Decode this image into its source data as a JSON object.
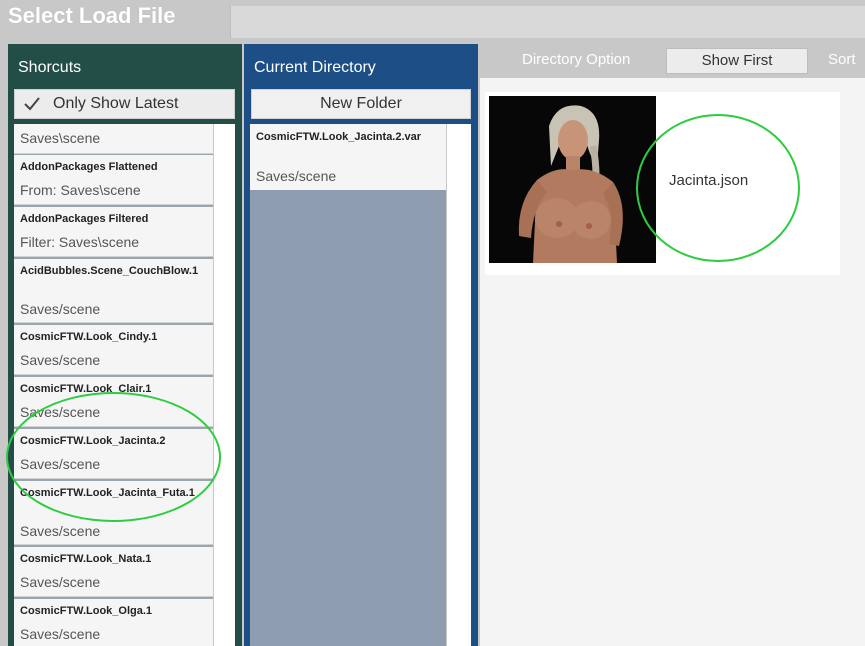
{
  "window": {
    "title": "Select Load File"
  },
  "shortcuts": {
    "header": "Shorcuts",
    "only_show_latest": "Only Show Latest",
    "checked": true,
    "items": [
      {
        "title": "",
        "subtitle": "Saves\\scene"
      },
      {
        "title": "AddonPackages Flattened",
        "subtitle": "From: Saves\\scene"
      },
      {
        "title": "AddonPackages Filtered",
        "subtitle": "Filter: Saves\\scene"
      },
      {
        "title": "AcidBubbles.Scene_CouchBlow.1",
        "subtitle": "Saves/scene"
      },
      {
        "title": "CosmicFTW.Look_Cindy.1",
        "subtitle": "Saves/scene"
      },
      {
        "title": "CosmicFTW.Look_Clair.1",
        "subtitle": "Saves/scene"
      },
      {
        "title": "CosmicFTW.Look_Jacinta.2",
        "subtitle": "Saves/scene"
      },
      {
        "title": "CosmicFTW.Look_Jacinta_Futa.1",
        "subtitle": "Saves/scene"
      },
      {
        "title": "CosmicFTW.Look_Nata.1",
        "subtitle": "Saves/scene"
      },
      {
        "title": "CosmicFTW.Look_Olga.1",
        "subtitle": "Saves/scene"
      }
    ]
  },
  "directory": {
    "header": "Current Directory",
    "new_folder": "New Folder",
    "item": {
      "title": "CosmicFTW.Look_Jacinta.2.var",
      "subtitle": "Saves/scene"
    }
  },
  "options": {
    "directory_option": "Directory Option",
    "show_first": "Show First",
    "sort": "Sort"
  },
  "files": [
    {
      "name": "Jacinta.json",
      "thumbnail": "character-portrait"
    }
  ],
  "colors": {
    "shortcuts_panel": "#234d47",
    "directory_panel": "#1d4e86",
    "highlight": "#2ecc40"
  }
}
